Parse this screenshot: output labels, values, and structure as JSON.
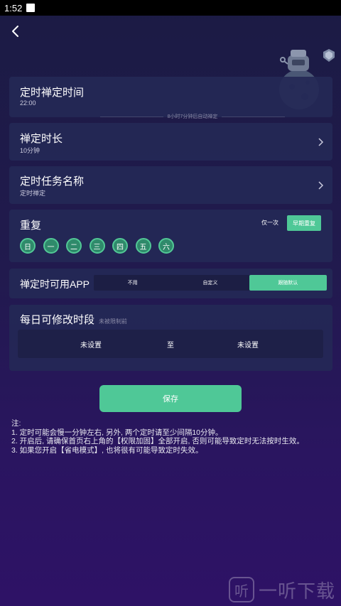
{
  "status_bar": {
    "time": "1:52"
  },
  "header": {
    "back_icon": "chevron-left-icon",
    "shield_icon": "shield-icon",
    "illustration": "robot-planet-icon"
  },
  "cards": {
    "timer": {
      "title": "定时禅定时间",
      "value": "22:00",
      "hint": "8小时7分钟后自动禅定"
    },
    "duration": {
      "title": "禅定时长",
      "value": "10分钟"
    },
    "task_name": {
      "title": "定时任务名称",
      "value": "定时禅定"
    },
    "repeat": {
      "title": "重复",
      "once_label": "仅一次",
      "workday_label": "早期重复",
      "days": [
        "日",
        "一",
        "二",
        "三",
        "四",
        "五",
        "六"
      ]
    },
    "apps": {
      "title": "禅定时可用APP",
      "options": [
        "不用",
        "自定义",
        "跟随默认"
      ],
      "selected": "跟随默认"
    },
    "edit_period": {
      "title": "每日可修改时段",
      "note": "未被限制前",
      "start": "未设置",
      "separator": "至",
      "end": "未设置"
    }
  },
  "save_label": "保存",
  "notes": {
    "heading": "注:",
    "lines": [
      "1. 定时可能会慢一分钟左右, 另外, 两个定时请至少间隔10分钟。",
      "2. 开启后, 请确保首页右上角的【权限加固】全部开启, 否则可能导致定时无法按时生效。",
      "3. 如果您开启【省电模式】, 也将很有可能导致定时失效。"
    ]
  },
  "watermark": {
    "text": "一听下载"
  },
  "colors": {
    "accent": "#4fc897",
    "card": "#242856",
    "background": "#1b1b44"
  }
}
